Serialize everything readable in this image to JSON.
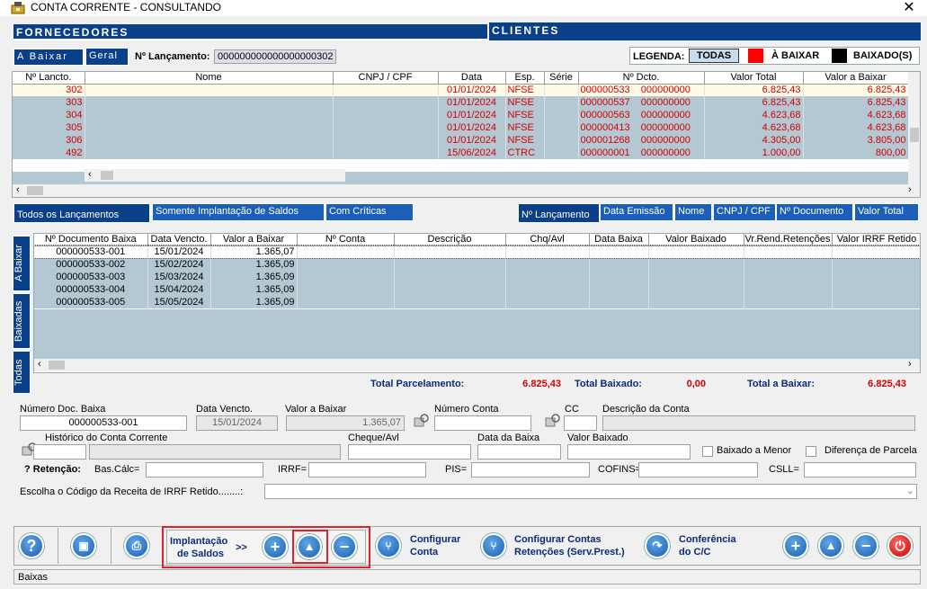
{
  "window": {
    "title": "CONTA CORRENTE   -   CONSULTANDO",
    "close": "✕"
  },
  "tabs_top": {
    "fornecedores": "FORNECEDORES",
    "clientes": "CLIENTES"
  },
  "subtabs": {
    "a_baixar": "A  Baixar",
    "geral": "Geral"
  },
  "lancamento": {
    "label": "Nº Lançamento:",
    "value": "000000000000000000302"
  },
  "legenda": {
    "label": "LEGENDA:",
    "todas": "TODAS",
    "a_baixar": "À BAIXAR",
    "baixados": "BAIXADO(S)",
    "color_red": "#ff0000",
    "color_black": "#000000"
  },
  "top_table": {
    "headers": [
      "Nº Lancto.",
      "Nome",
      "CNPJ / CPF",
      "Data",
      "Esp.",
      "Série",
      "Nº Dcto.",
      "Valor Total",
      "Valor a Baixar"
    ],
    "rows": [
      {
        "lancto": "302",
        "nome": "",
        "cnpj": "",
        "data": "01/01/2024",
        "esp": "NFSE",
        "serie": "",
        "dcto": "000000533",
        "dcto2": "000000000",
        "total": "6.825,43",
        "baixar": "6.825,43"
      },
      {
        "lancto": "303",
        "nome": "",
        "cnpj": "",
        "data": "01/01/2024",
        "esp": "NFSE",
        "serie": "",
        "dcto": "000000537",
        "dcto2": "000000000",
        "total": "6.825,43",
        "baixar": "6.825,43"
      },
      {
        "lancto": "304",
        "nome": "",
        "cnpj": "",
        "data": "01/01/2024",
        "esp": "NFSE",
        "serie": "",
        "dcto": "000000563",
        "dcto2": "000000000",
        "total": "4.623,68",
        "baixar": "4.623,68"
      },
      {
        "lancto": "305",
        "nome": "",
        "cnpj": "",
        "data": "01/01/2024",
        "esp": "NFSE",
        "serie": "",
        "dcto": "000000413",
        "dcto2": "000000000",
        "total": "4.623,68",
        "baixar": "4.623,68"
      },
      {
        "lancto": "306",
        "nome": "",
        "cnpj": "",
        "data": "01/01/2024",
        "esp": "NFSE",
        "serie": "",
        "dcto": "000001268",
        "dcto2": "000000000",
        "total": "4.305,00",
        "baixar": "3.805,00"
      },
      {
        "lancto": "492",
        "nome": "",
        "cnpj": "",
        "data": "15/06/2024",
        "esp": "CTRC",
        "serie": "",
        "dcto": "000000001",
        "dcto2": "000000000",
        "total": "1.000,00",
        "baixar": "800,00"
      }
    ]
  },
  "filters": {
    "todos": "Todos os Lançamentos",
    "somente": "Somente Implantação de Saldos",
    "criticas": "Com Críticas"
  },
  "sort": {
    "lanc": "Nº Lançamento",
    "emissao": "Data Emissão",
    "nome": "Nome",
    "cnpj": "CNPJ / CPF",
    "doc": "Nº Documento",
    "total": "Valor Total"
  },
  "vtabs": {
    "a_baixar": "A Baixar",
    "baixadas": "Baixadas",
    "todas": "Todas"
  },
  "bottom_table": {
    "headers": [
      "Nº Documento Baixa",
      "Data Vencto.",
      "Valor a Baixar",
      "Nº Conta",
      "Descrição",
      "Chq/Avl",
      "Data Baixa",
      "Valor Baixado",
      "Vr.Rend.Retenções",
      "Valor IRRF Retido"
    ],
    "rows": [
      {
        "doc": "000000533-001",
        "venc": "15/01/2024",
        "valor": "1.365,07"
      },
      {
        "doc": "000000533-002",
        "venc": "15/02/2024",
        "valor": "1.365,09"
      },
      {
        "doc": "000000533-003",
        "venc": "15/03/2024",
        "valor": "1.365,09"
      },
      {
        "doc": "000000533-004",
        "venc": "15/04/2024",
        "valor": "1.365,09"
      },
      {
        "doc": "000000533-005",
        "venc": "15/05/2024",
        "valor": "1.365,09"
      }
    ]
  },
  "totals": {
    "parc_label": "Total Parcelamento:",
    "parc": "6.825,43",
    "baix_label": "Total Baixado:",
    "baix": "0,00",
    "abaixar_label": "Total a Baixar:",
    "abaixar": "6.825,43"
  },
  "form": {
    "num_doc_label": "Número Doc. Baixa",
    "num_doc": "000000533-001",
    "venc_label": "Data Vencto.",
    "venc": "15/01/2024",
    "valor_label": "Valor a Baixar",
    "valor": "1.365,07",
    "conta_label": "Número Conta",
    "cc_label": "CC",
    "desc_label": "Descrição da Conta",
    "hist_label": "Histórico do Conta Corrente",
    "cheque_label": "Cheque/Avl",
    "data_baixa_label": "Data da Baixa",
    "valor_baixado_label": "Valor Baixado",
    "menor_label": "Baixado a Menor",
    "dif_label": "Diferença de Parcela",
    "ret_label": "? Retenção:",
    "bas_label": "Bas.Cálc=",
    "irrf_label": "IRRF=",
    "pis_label": "PIS=",
    "cofins_label": "COFINS=",
    "csll_label": "CSLL=",
    "receita_label": "Escolha o Código da Receita de IRRF Retido........:"
  },
  "toolbar": {
    "impl_line1": "Implantação",
    "impl_line2": "de Saldos",
    "impl_arrow": ">>",
    "cfg_conta1": "Configurar",
    "cfg_conta2": "Conta",
    "cfg_ret1": "Configurar Contas",
    "cfg_ret2": "Retenções (Serv.Prest.)",
    "conf1": "Conferência",
    "conf2": "do C/C"
  },
  "status": {
    "text": "Baixas"
  }
}
